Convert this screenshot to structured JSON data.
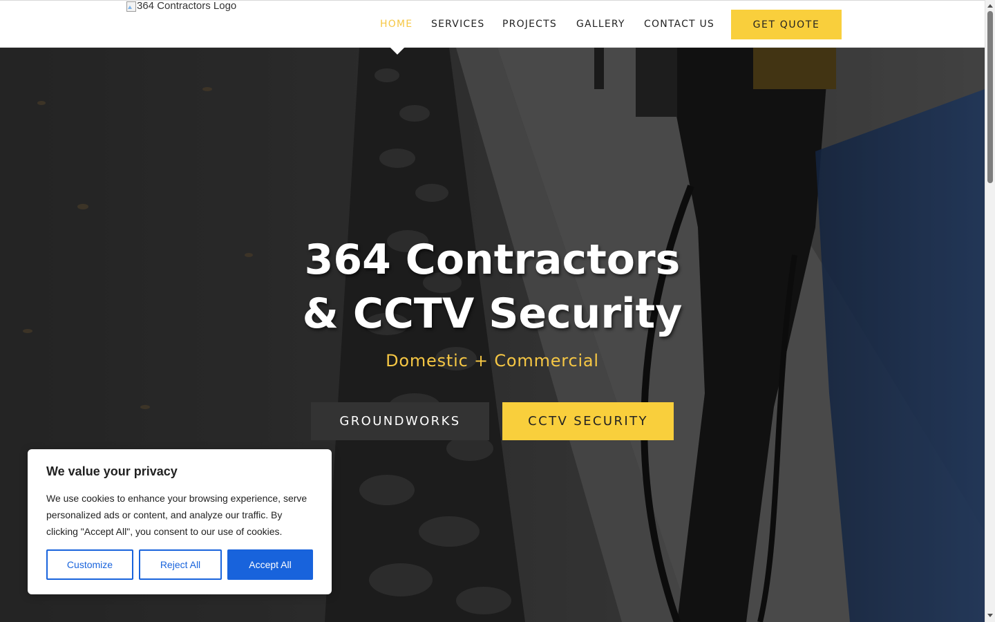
{
  "header": {
    "logo_alt": "364 Contractors Logo",
    "nav": [
      {
        "label": "HOME",
        "active": true
      },
      {
        "label": "SERVICES",
        "active": false
      },
      {
        "label": "PROJECTS",
        "active": false
      },
      {
        "label": "GALLERY",
        "active": false
      },
      {
        "label": "CONTACT US",
        "active": false
      }
    ],
    "cta_label": "GET QUOTE"
  },
  "hero": {
    "title_line1": "364 Contractors",
    "title_line2": "& CCTV Security",
    "subtitle": "Domestic + Commercial",
    "buttons": [
      {
        "label": "GROUNDWORKS"
      },
      {
        "label": "CCTV SECURITY"
      }
    ]
  },
  "cookie_banner": {
    "title": "We value your privacy",
    "text": "We use cookies to enhance your browsing experience, serve personalized ads or content, and analyze our traffic. By clicking \"Accept All\", you consent to our use of cookies.",
    "buttons": {
      "customize": "Customize",
      "reject": "Reject All",
      "accept": "Accept All"
    }
  },
  "colors": {
    "accent": "#f9cf3c",
    "active_nav": "#f6c744",
    "dark_button": "#333333",
    "cookie_primary": "#1863dc"
  },
  "icons": [
    "broken-image-icon",
    "scroll-up-arrow-icon",
    "scroll-down-arrow-icon"
  ]
}
